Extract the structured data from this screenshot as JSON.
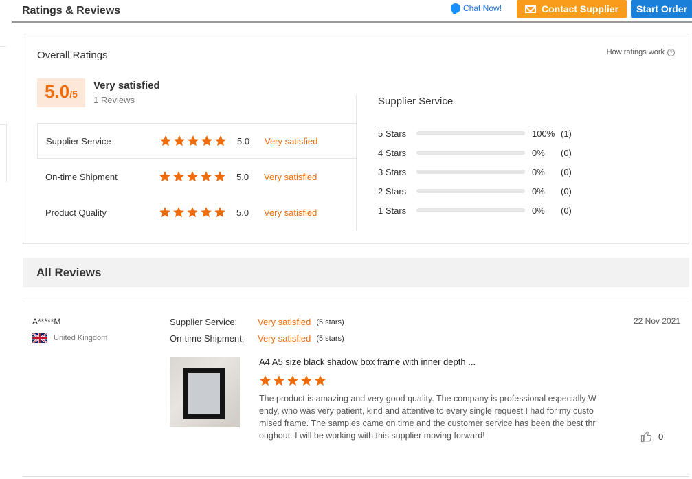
{
  "header": {
    "title": "Ratings & Reviews",
    "chat_label": "Chat Now!",
    "contact_label": "Contact Supplier",
    "start_label": "Start Order"
  },
  "overall": {
    "title": "Overall Ratings",
    "how_link": "How ratings work",
    "score": "5.0",
    "score_max": "/5",
    "satisfaction": "Very satisfied",
    "review_count": "1 Reviews",
    "categories": [
      {
        "label": "Supplier Service",
        "stars": 5,
        "score": "5.0",
        "satisfaction": "Very satisfied"
      },
      {
        "label": "On-time Shipment",
        "stars": 5,
        "score": "5.0",
        "satisfaction": "Very satisfied"
      },
      {
        "label": "Product Quality",
        "stars": 5,
        "score": "5.0",
        "satisfaction": "Very satisfied"
      }
    ]
  },
  "distribution": {
    "title": "Supplier Service",
    "rows": [
      {
        "label": "5 Stars",
        "fraction": 1.0,
        "percent": "100%",
        "count": "(1)"
      },
      {
        "label": "4 Stars",
        "fraction": 0,
        "percent": "0%",
        "count": "(0)"
      },
      {
        "label": "3 Stars",
        "fraction": 0,
        "percent": "0%",
        "count": "(0)"
      },
      {
        "label": "2 Stars",
        "fraction": 0,
        "percent": "0%",
        "count": "(0)"
      },
      {
        "label": "1 Stars",
        "fraction": 0,
        "percent": "0%",
        "count": "(0)"
      }
    ]
  },
  "reviews": {
    "section_title": "All Reviews",
    "items": [
      {
        "user": "A*****M",
        "country": "United Kingdom",
        "supplier_service_label": "Supplier Service:",
        "supplier_service_value": "Very satisfied",
        "supplier_service_stars": "(5 stars)",
        "shipment_label": "On-time Shipment:",
        "shipment_value": "Very satisfied",
        "shipment_stars": "(5 stars)",
        "date": "22 Nov 2021",
        "product_title": "A4 A5 size black shadow box frame with inner depth ...",
        "rating": 5,
        "text": "The product is amazing and very good quality. The company is professional especially Wendy, who was very patient, kind and attentive to every single request I had for my customised frame. The samples came on time and the customer service has been the best throughout. I will be working with this supplier moving forward!",
        "likes": "0"
      }
    ]
  },
  "colors": {
    "accent": "#f06b0a",
    "contact_button": "#f99c1c",
    "start_button": "#1a7fd8",
    "chat_link": "#1a73e8",
    "star": "#f06b0a"
  },
  "icons": [
    "chat-icon",
    "mail-icon",
    "question-icon",
    "star-icon",
    "uk-flag-icon",
    "thumbs-up-icon"
  ]
}
